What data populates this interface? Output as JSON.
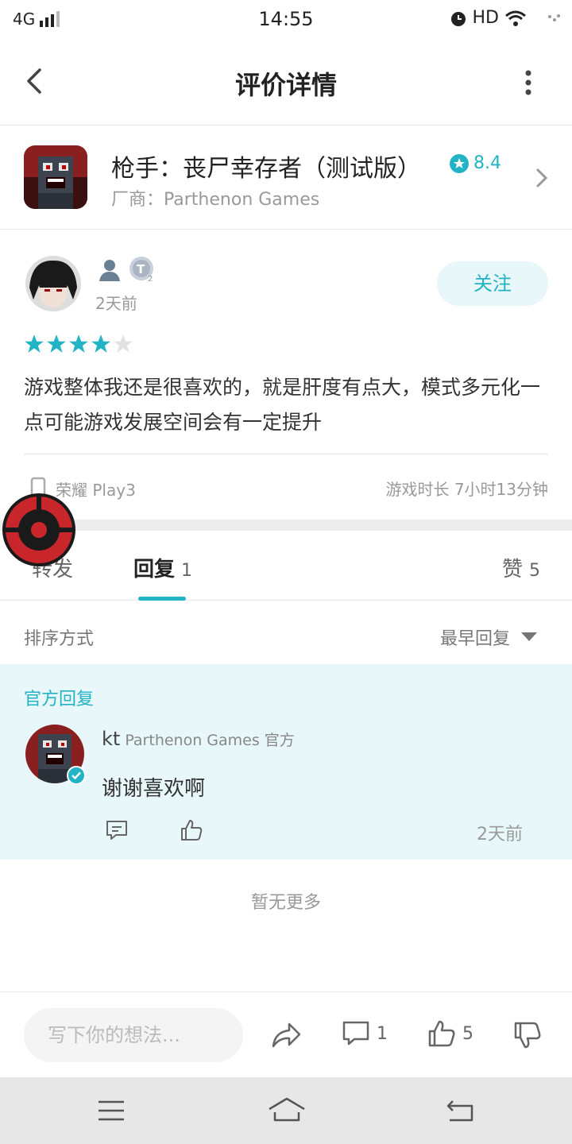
{
  "status_bar": {
    "network": "4G",
    "time": "14:55",
    "hd": "HD"
  },
  "header": {
    "title": "评价详情"
  },
  "game": {
    "name": "枪手：丧尸幸存者（测试版）",
    "rating": "8.4",
    "vendor": "厂商：Parthenon Games"
  },
  "review": {
    "time": "2天前",
    "follow_label": "关注",
    "stars": 4,
    "text": "游戏整体我还是很喜欢的，就是肝度有点大，模式多元化一点可能游戏发展空间会有一定提升",
    "device": "荣耀 Play3",
    "playtime": "游戏时长 7小时13分钟"
  },
  "tabs": {
    "forward": "转发",
    "reply": "回复",
    "reply_count": "1",
    "like": "赞",
    "like_count": "5"
  },
  "sort": {
    "label": "排序方式",
    "selected": "最早回复"
  },
  "official_reply": {
    "label": "官方回复",
    "name": "kt",
    "org": "Parthenon Games 官方",
    "text": "谢谢喜欢啊",
    "time": "2天前"
  },
  "no_more": "暂无更多",
  "action_bar": {
    "placeholder": "写下你的想法...",
    "comment_count": "1",
    "like_count": "5"
  },
  "colors": {
    "accent": "#22b3c4",
    "official_bg": "#e8f7fa"
  }
}
